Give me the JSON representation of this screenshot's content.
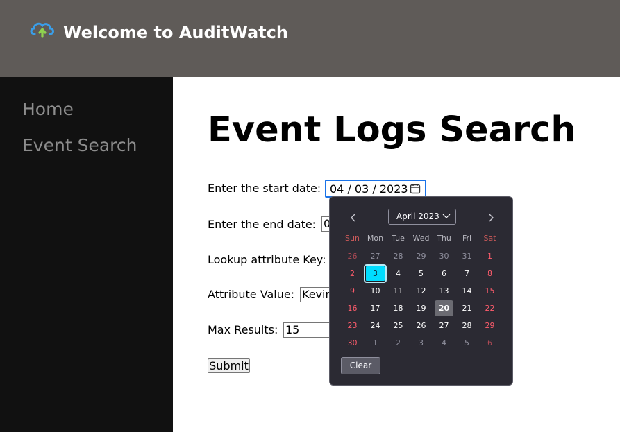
{
  "header": {
    "title": "Welcome to AuditWatch",
    "logo_icon": "cloud-upload-icon"
  },
  "sidebar": {
    "items": [
      {
        "label": "Home"
      },
      {
        "label": "Event Search"
      }
    ]
  },
  "main": {
    "title": "Event Logs Search",
    "fields": {
      "start_date": {
        "label": "Enter the start date:",
        "value": "04 / 03 / 2023"
      },
      "end_date": {
        "label": "Enter the end date:",
        "value": "0"
      },
      "attr_key": {
        "label": "Lookup attribute Key:",
        "value": ""
      },
      "attr_value": {
        "label": "Attribute Value:",
        "value": "Kevin"
      },
      "max_results": {
        "label": "Max Results:",
        "value": "15"
      }
    },
    "submit_label": "Submit"
  },
  "datepicker": {
    "month_label": "April 2023",
    "weekdays": [
      "Sun",
      "Mon",
      "Tue",
      "Wed",
      "Thu",
      "Fri",
      "Sat"
    ],
    "weeks": [
      [
        "26",
        "27",
        "28",
        "29",
        "30",
        "31",
        "1"
      ],
      [
        "2",
        "3",
        "4",
        "5",
        "6",
        "7",
        "8"
      ],
      [
        "9",
        "10",
        "11",
        "12",
        "13",
        "14",
        "15"
      ],
      [
        "16",
        "17",
        "18",
        "19",
        "20",
        "21",
        "22"
      ],
      [
        "23",
        "24",
        "25",
        "26",
        "27",
        "28",
        "29"
      ],
      [
        "30",
        "1",
        "2",
        "3",
        "4",
        "5",
        "6"
      ]
    ],
    "selected_day": "3",
    "today_day": "20",
    "clear_label": "Clear",
    "colors": {
      "background": "#2b2a33",
      "selected": "#00ddff",
      "weekend": "#ff5c6c"
    }
  }
}
